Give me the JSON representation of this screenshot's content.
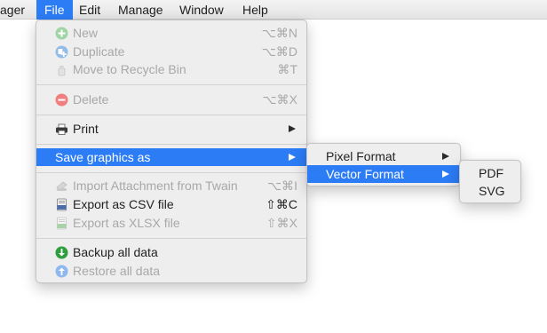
{
  "menubar": {
    "items": [
      {
        "label": "ager"
      },
      {
        "label": "File"
      },
      {
        "label": "Edit"
      },
      {
        "label": "Manage"
      },
      {
        "label": "Window"
      },
      {
        "label": "Help"
      }
    ],
    "active": "File"
  },
  "file_menu": {
    "items": [
      {
        "label": "New",
        "shortcut": "⌥⌘N",
        "icon": "plus-circle-icon",
        "enabled": false
      },
      {
        "label": "Duplicate",
        "shortcut": "⌥⌘D",
        "icon": "duplicate-icon",
        "enabled": false
      },
      {
        "label": "Move to Recycle Bin",
        "shortcut": "⌘T",
        "icon": "trash-icon",
        "enabled": false
      },
      {
        "label": "Delete",
        "shortcut": "⌥⌘X",
        "icon": "minus-circle-icon",
        "enabled": false
      },
      {
        "label": "Print",
        "shortcut": "",
        "icon": "printer-icon",
        "enabled": true,
        "submenu": true
      },
      {
        "label": "Save graphics as",
        "shortcut": "",
        "icon": "",
        "enabled": true,
        "submenu": true,
        "highlighted": true
      },
      {
        "label": "Import Attachment from Twain",
        "shortcut": "⌥⌘I",
        "icon": "scanner-icon",
        "enabled": false
      },
      {
        "label": "Export as CSV file",
        "shortcut": "⇧⌘C",
        "icon": "csv-file-icon",
        "enabled": true
      },
      {
        "label": "Export as XLSX file",
        "shortcut": "⇧⌘X",
        "icon": "xlsx-file-icon",
        "enabled": false
      },
      {
        "label": "Backup all data",
        "shortcut": "",
        "icon": "backup-download-icon",
        "enabled": true
      },
      {
        "label": "Restore all data",
        "shortcut": "",
        "icon": "restore-upload-icon",
        "enabled": false
      }
    ]
  },
  "save_graphics_submenu": {
    "items": [
      {
        "label": "Pixel Format",
        "submenu": true
      },
      {
        "label": "Vector Format",
        "submenu": true,
        "highlighted": true
      }
    ]
  },
  "vector_format_submenu": {
    "items": [
      {
        "label": "PDF"
      },
      {
        "label": "SVG"
      }
    ]
  },
  "colors": {
    "highlight": "#2c7cf6",
    "menu_background": "#eeeeee",
    "disabled_text": "#a8a8a8",
    "backup_icon": "#2e9e3e",
    "restore_icon": "#8fb8ee",
    "delete_icon": "#f08080"
  }
}
